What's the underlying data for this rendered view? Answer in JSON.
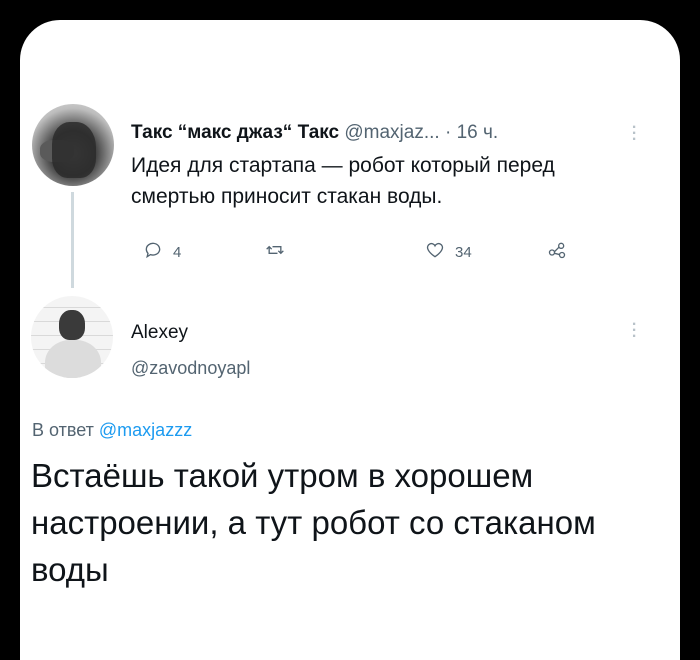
{
  "tweet1": {
    "display_name": "Такс “макс джаз“ Такс",
    "handle": "@maxjaz...",
    "time": "· 16 ч.",
    "text": "Идея для стартапа — робот который перед смертью приносит стакан воды.",
    "replies": "4",
    "retweets": "",
    "likes": "34"
  },
  "tweet2": {
    "display_name": "Alexey",
    "handle": "@zavodnoyapl",
    "reply_prefix": "В ответ",
    "reply_handle": "@maxjazzz",
    "text": "Встаёшь такой утром в хорошем настроении, а тут робот со стаканом воды"
  },
  "icons": {
    "reply": "comment-icon",
    "retweet": "retweet-icon",
    "like": "heart-icon",
    "share": "share-icon",
    "more": "more-options-icon"
  },
  "colors": {
    "text": "#0f1419",
    "muted": "#536471",
    "link": "#1d9bf0",
    "thread_line": "#cfd9de"
  }
}
